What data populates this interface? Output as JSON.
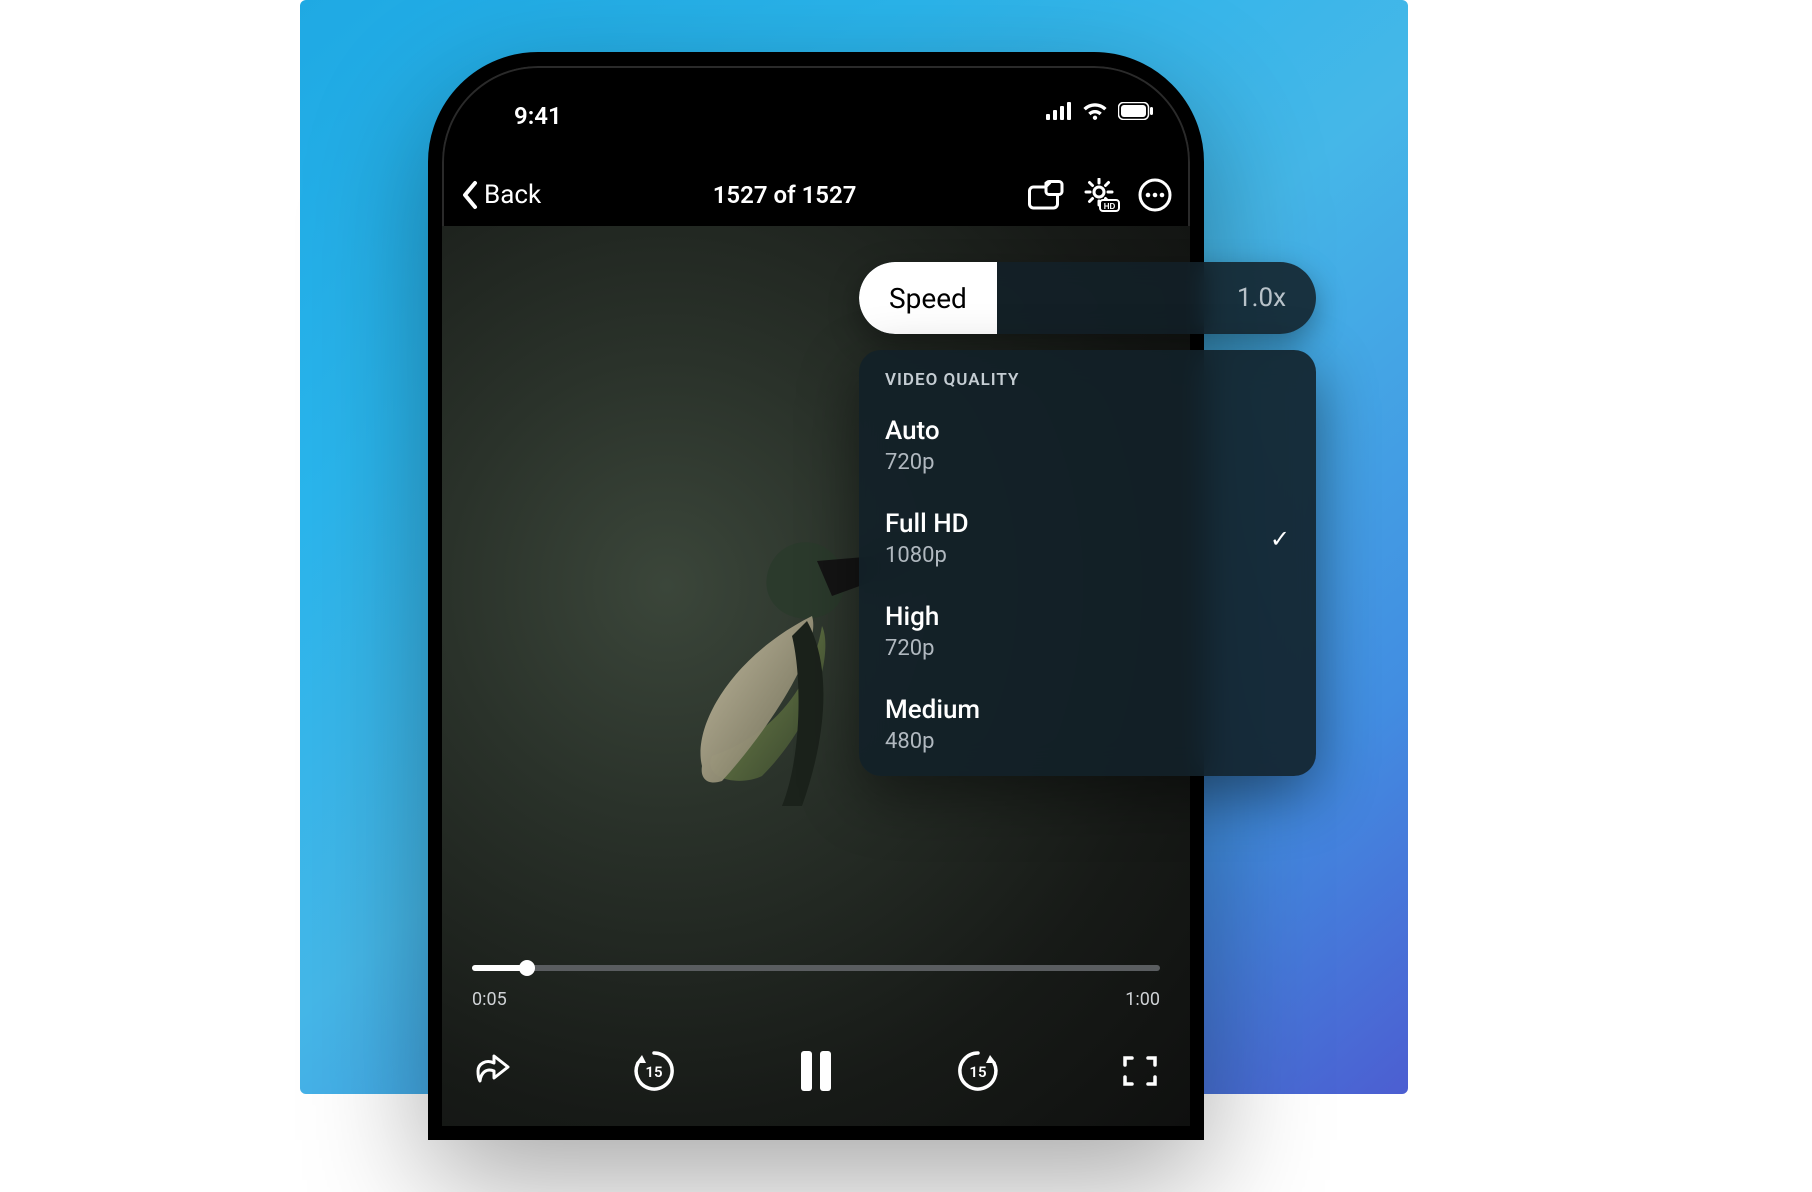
{
  "status": {
    "time": "9:41"
  },
  "nav": {
    "back_label": "Back",
    "title": "1527 of 1527"
  },
  "speed": {
    "label": "Speed",
    "value": "1.0x"
  },
  "quality": {
    "header": "VIDEO QUALITY",
    "options": [
      {
        "title": "Auto",
        "sub": "720p",
        "selected": false
      },
      {
        "title": "Full HD",
        "sub": "1080p",
        "selected": true
      },
      {
        "title": "High",
        "sub": "720p",
        "selected": false
      },
      {
        "title": "Medium",
        "sub": "480p",
        "selected": false
      }
    ]
  },
  "player": {
    "current_time": "0:05",
    "duration": "1:00",
    "progress_pct": 8,
    "skip_seconds": "15"
  }
}
